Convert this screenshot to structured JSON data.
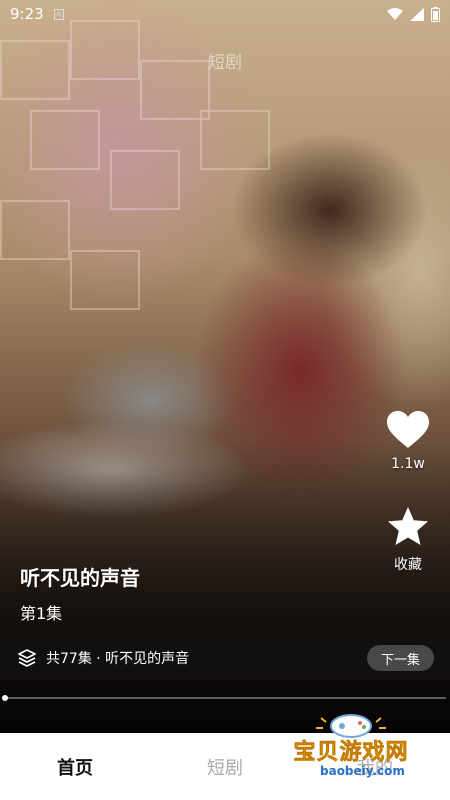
{
  "status_bar": {
    "time": "9:23",
    "sim_icon": "A",
    "icons": [
      "wifi-icon",
      "signal-icon",
      "battery-icon"
    ]
  },
  "header": {
    "label": "短剧"
  },
  "actions": {
    "like": {
      "icon": "heart-icon",
      "count": "1.1w"
    },
    "favorite": {
      "icon": "star-icon",
      "label": "收藏"
    }
  },
  "video": {
    "title": "听不见的声音",
    "episode": "第1集",
    "series_info": "共77集 · 听不见的声音",
    "series_icon": "layers-icon",
    "next_label": "下一集",
    "progress": 0.0
  },
  "nav": {
    "tabs": [
      {
        "label": "首页"
      },
      {
        "label": "短剧"
      },
      {
        "label": "我的"
      }
    ],
    "active_index": 0
  },
  "watermark": {
    "text": "宝贝游戏网",
    "url": "baobeiy.com",
    "colors": {
      "gold": "#f2b51f",
      "blue": "#2a6fc7"
    }
  },
  "colors": {
    "nav_bg": "#ffffff",
    "active_tab": "#111111",
    "inactive_tab": "#aaaaaa"
  }
}
